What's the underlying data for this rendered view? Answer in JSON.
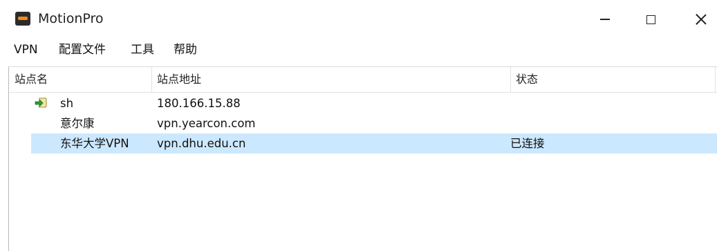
{
  "window": {
    "title": "MotionPro",
    "controls": [
      "minimize",
      "maximize",
      "close"
    ]
  },
  "menu": [
    "VPN",
    "配置文件",
    "工具",
    "帮助"
  ],
  "table": {
    "columns": [
      "站点名",
      "站点地址",
      "状态"
    ],
    "rows": [
      {
        "name": "sh",
        "address": "180.166.15.88",
        "status": "",
        "icon": "connect-arrow-icon",
        "selected": false
      },
      {
        "name": "意尔康",
        "address": "vpn.yearcon.com",
        "status": "",
        "selected": false
      },
      {
        "name": "东华大学VPN",
        "address": "vpn.dhu.edu.cn",
        "status": "已连接",
        "selected": true
      }
    ]
  },
  "colors": {
    "selection": "#cce8ff",
    "app_icon_bg": "#2b2b2b",
    "app_icon_accent": "#f08a1c"
  }
}
